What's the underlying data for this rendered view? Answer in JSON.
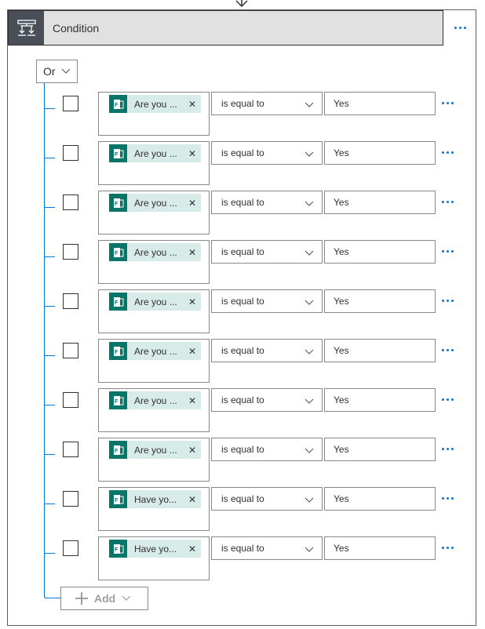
{
  "header": {
    "title": "Condition",
    "icon": "condition-icon",
    "accent": "#0078d4"
  },
  "group": {
    "operator": "Or"
  },
  "rows": [
    {
      "token_label": "Are you ...",
      "token_icon": "forms-icon",
      "operator": "is equal to",
      "value": "Yes"
    },
    {
      "token_label": "Are you ...",
      "token_icon": "forms-icon",
      "operator": "is equal to",
      "value": "Yes"
    },
    {
      "token_label": "Are you ...",
      "token_icon": "forms-icon",
      "operator": "is equal to",
      "value": "Yes"
    },
    {
      "token_label": "Are you ...",
      "token_icon": "forms-icon",
      "operator": "is equal to",
      "value": "Yes"
    },
    {
      "token_label": "Are you ...",
      "token_icon": "forms-icon",
      "operator": "is equal to",
      "value": "Yes"
    },
    {
      "token_label": "Are you ...",
      "token_icon": "forms-icon",
      "operator": "is equal to",
      "value": "Yes"
    },
    {
      "token_label": "Are you ...",
      "token_icon": "forms-icon",
      "operator": "is equal to",
      "value": "Yes"
    },
    {
      "token_label": "Are you ...",
      "token_icon": "forms-icon",
      "operator": "is equal to",
      "value": "Yes"
    },
    {
      "token_label": "Have yo...",
      "token_icon": "forms-icon",
      "operator": "is equal to",
      "value": "Yes"
    },
    {
      "token_label": "Have yo...",
      "token_icon": "forms-icon",
      "operator": "is equal to",
      "value": "Yes"
    }
  ],
  "add_button": {
    "label": "Add"
  },
  "colors": {
    "header_bg": "#e1e1e1",
    "header_icon_bg": "#484f58",
    "token_bg": "#d7ebe8",
    "forms_icon_bg": "#077568",
    "tree_line": "#0078d4"
  }
}
